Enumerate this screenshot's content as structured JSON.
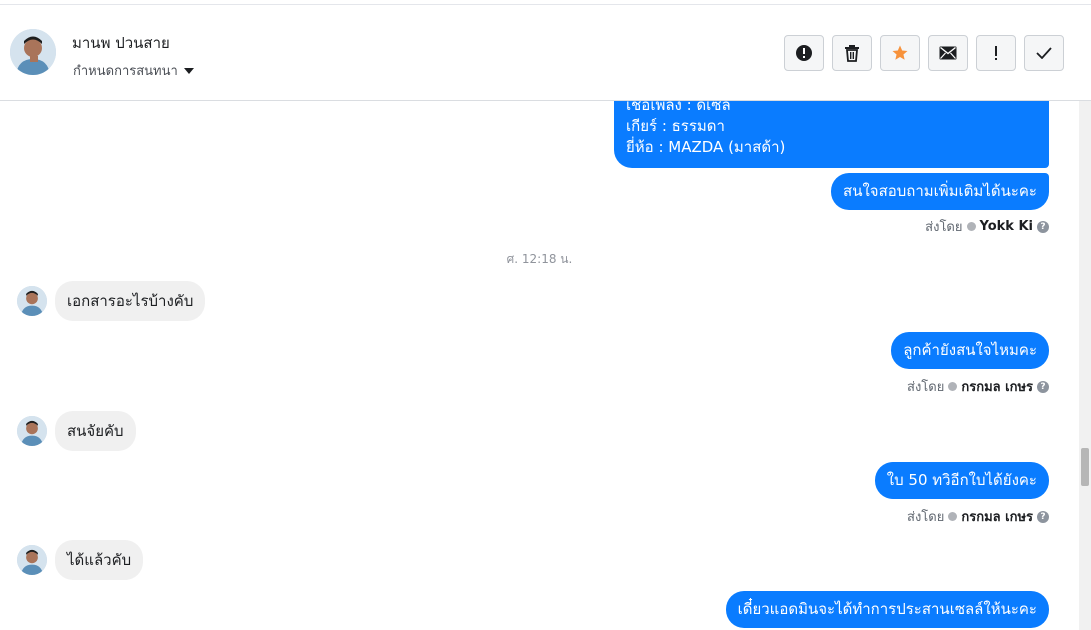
{
  "header": {
    "name": "มานพ ปวนสาย",
    "subtitle": "กำหนดการสนทนา"
  },
  "actions": [
    {
      "name": "report-icon",
      "glyph": "!"
    },
    {
      "name": "trash-icon",
      "glyph": ""
    },
    {
      "name": "star-icon",
      "glyph": ""
    },
    {
      "name": "mail-icon",
      "glyph": ""
    },
    {
      "name": "exclamation-icon",
      "glyph": "!"
    },
    {
      "name": "check-icon",
      "glyph": ""
    }
  ],
  "colors": {
    "accent": "#0a7cff",
    "star": "#f7923b"
  },
  "messages": {
    "m1_line1": "เชื้อเพลิง : ดีเซล",
    "m1_line2": "เกียร์ : ธรรมดา",
    "m1_line3": "ยี่ห้อ : MAZDA (มาสด้า)",
    "m2": "สนใจสอบถามเพิ่มเติมได้นะคะ",
    "sent1_prefix": "ส่งโดย",
    "sent1_name": "Yokk Ki",
    "time": "ศ. 12:18 น.",
    "in1": "เอกสารอะไรบ้างคับ",
    "out3": "ลูกค้ายังสนใจไหมคะ",
    "sent2_prefix": "ส่งโดย",
    "sent2_name": "กรกมล เกษร",
    "in2": "สนจัยคับ",
    "out4": "ใบ 50 ทวิอีกใบได้ยังคะ",
    "sent3_prefix": "ส่งโดย",
    "sent3_name": "กรกมล เกษร",
    "in3": "ได้แล้วคับ",
    "out5": "เดี๋ยวแอดมินจะได้ทำการประสานเซลล์ให้นะคะ"
  }
}
